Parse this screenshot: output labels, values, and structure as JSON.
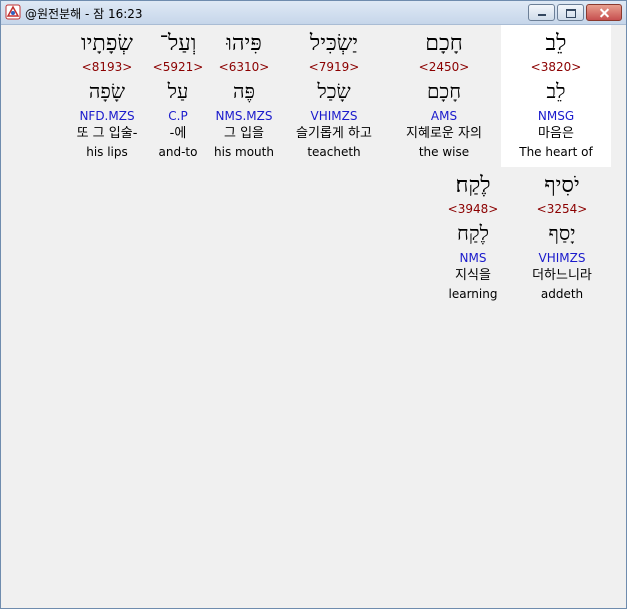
{
  "window": {
    "title": "@원전분해 - 잠 16:23"
  },
  "words": [
    {
      "hebrew": "לֵב",
      "strong": "<3820>",
      "lemma": "לֵב",
      "morph": "NMSG",
      "korean": "마음은",
      "english": "The heart of",
      "selected": true
    },
    {
      "hebrew": "חָכָם",
      "strong": "<2450>",
      "lemma": "חָכָם",
      "morph": "AMS",
      "korean": "지혜로운 자의",
      "english": "the wise",
      "selected": false
    },
    {
      "hebrew": "יַשְׂכִּיל",
      "strong": "<7919>",
      "lemma": "שָׂכַל",
      "morph": "VHIMZS",
      "korean": "슬기롭게 하고",
      "english": "teacheth",
      "selected": false
    },
    {
      "hebrew": "פִּיהוּ",
      "strong": "<6310>",
      "lemma": "פֶּה",
      "morph": "NMS.MZS",
      "korean": "그 입을",
      "english": "his mouth",
      "selected": false
    },
    {
      "hebrew": "וְעַל־",
      "strong": "<5921>",
      "lemma": "עַל",
      "morph": "C.P",
      "korean": "-에",
      "english": "and-to",
      "selected": false
    },
    {
      "hebrew": "שְׂפָתָיו",
      "strong": "<8193>",
      "lemma": "שָׂפָה",
      "morph": "NFD.MZS",
      "korean": "또 그 입술-",
      "english": "his lips",
      "selected": false
    },
    {
      "hebrew": "יֹסִיף",
      "strong": "<3254>",
      "lemma": "יָסַף",
      "morph": "VHIMZS",
      "korean": "더하느니라",
      "english": "addeth",
      "selected": false
    },
    {
      "hebrew": "לֶקַח׃",
      "strong": "<3948>",
      "lemma": "לֶקַח",
      "morph": "NMS",
      "korean": "지식을",
      "english": "learning",
      "selected": false
    }
  ]
}
